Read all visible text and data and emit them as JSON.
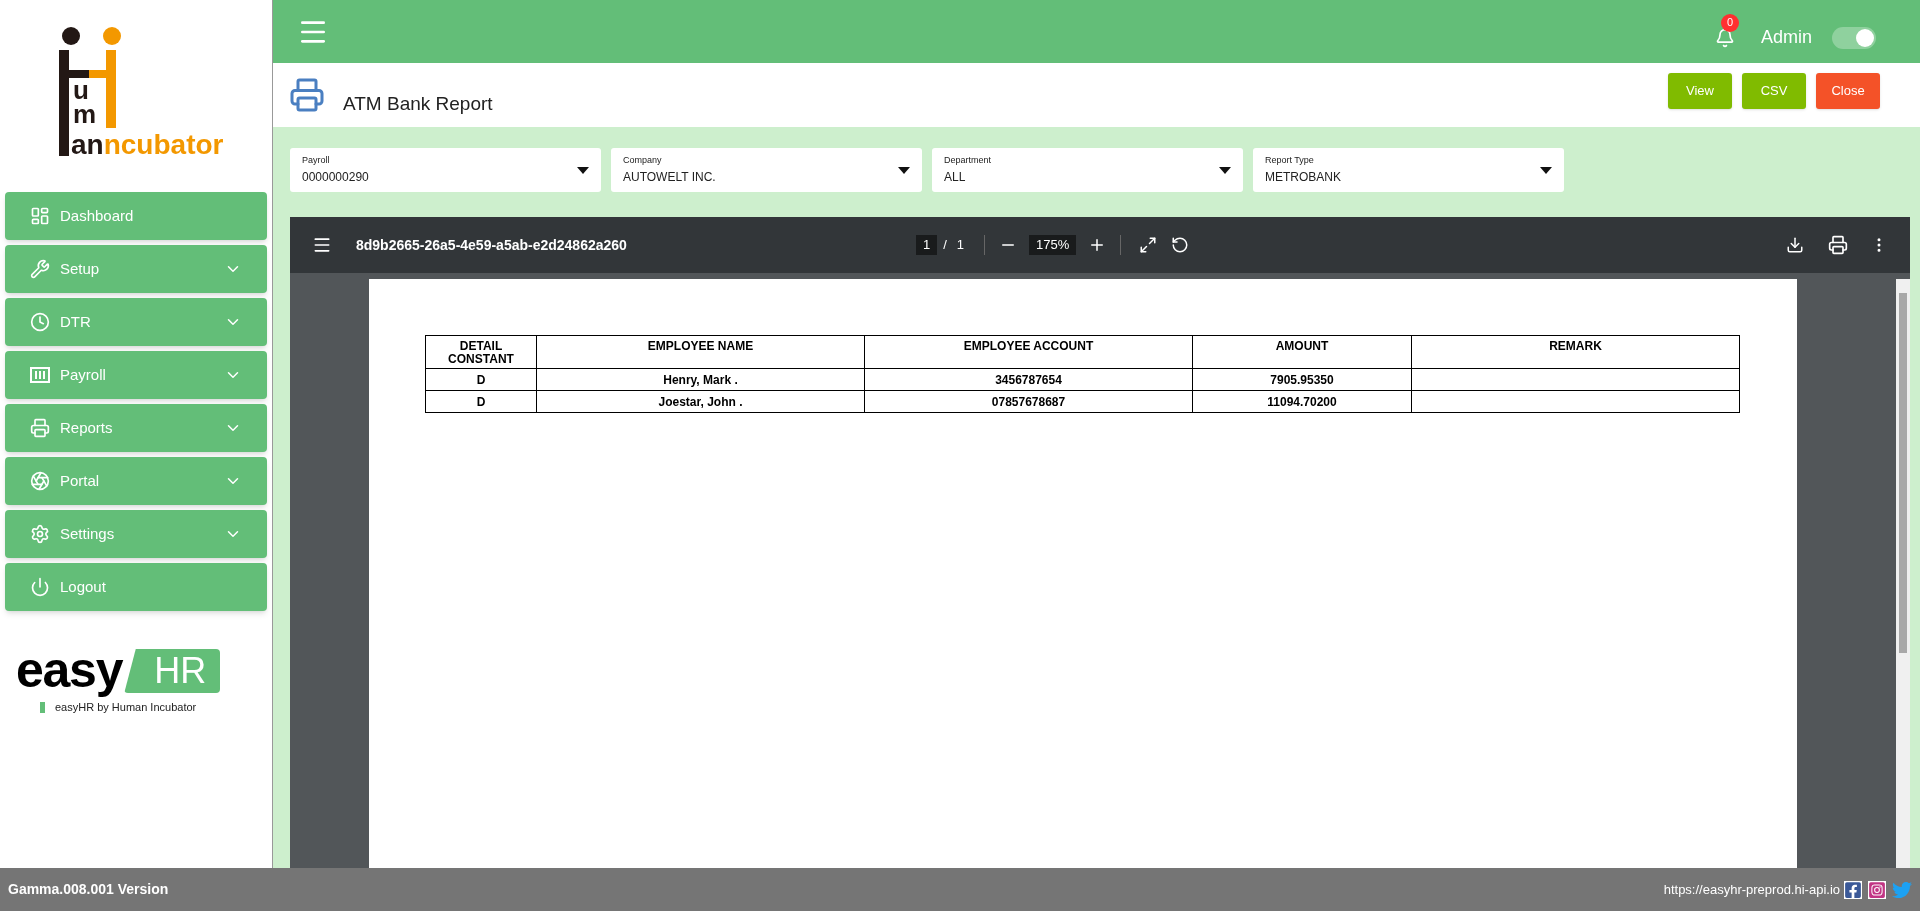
{
  "sidebar": {
    "logo": {
      "stack": [
        "u",
        "m"
      ],
      "dark": "an",
      "orange": "ncubator"
    },
    "items": [
      {
        "label": "Dashboard",
        "has_submenu": false
      },
      {
        "label": "Setup",
        "has_submenu": true
      },
      {
        "label": "DTR",
        "has_submenu": true
      },
      {
        "label": "Payroll",
        "has_submenu": true
      },
      {
        "label": "Reports",
        "has_submenu": true
      },
      {
        "label": "Portal",
        "has_submenu": true
      },
      {
        "label": "Settings",
        "has_submenu": true
      },
      {
        "label": "Logout",
        "has_submenu": false
      }
    ],
    "brand": {
      "word": "easy",
      "tag": "HR",
      "tagline": "easyHR by Human Incubator"
    }
  },
  "header": {
    "notification_count": "0",
    "user": "Admin",
    "theme_toggle": {
      "on": true
    }
  },
  "page": {
    "title": "ATM Bank Report",
    "buttons": [
      {
        "label": "View",
        "kind": "primary"
      },
      {
        "label": "CSV",
        "kind": "primary"
      },
      {
        "label": "Close",
        "kind": "danger"
      }
    ]
  },
  "filters": [
    {
      "label": "Payroll",
      "value": "0000000290"
    },
    {
      "label": "Company",
      "value": "AUTOWELT INC."
    },
    {
      "label": "Department",
      "value": "ALL"
    },
    {
      "label": "Report Type",
      "value": "METROBANK"
    }
  ],
  "pdf_viewer": {
    "file_name": "8d9b2665-26a5-4e59-a5ab-e2d24862a260",
    "page": "1",
    "page_separator": "/",
    "page_count": "1",
    "zoom": "175%",
    "table": {
      "columns": [
        "DETAIL CONSTANT",
        "EMPLOYEE NAME",
        "EMPLOYEE ACCOUNT",
        "AMOUNT",
        "REMARK"
      ],
      "rows": [
        [
          "D",
          "Henry, Mark .",
          "3456787654",
          "7905.95350",
          ""
        ],
        [
          "D",
          "Joestar, John .",
          "07857678687",
          "11094.70200",
          ""
        ]
      ]
    }
  },
  "footer": {
    "version": "Gamma.008.001 Version",
    "url": "https://easyhr-preprod.hi-api.io"
  }
}
